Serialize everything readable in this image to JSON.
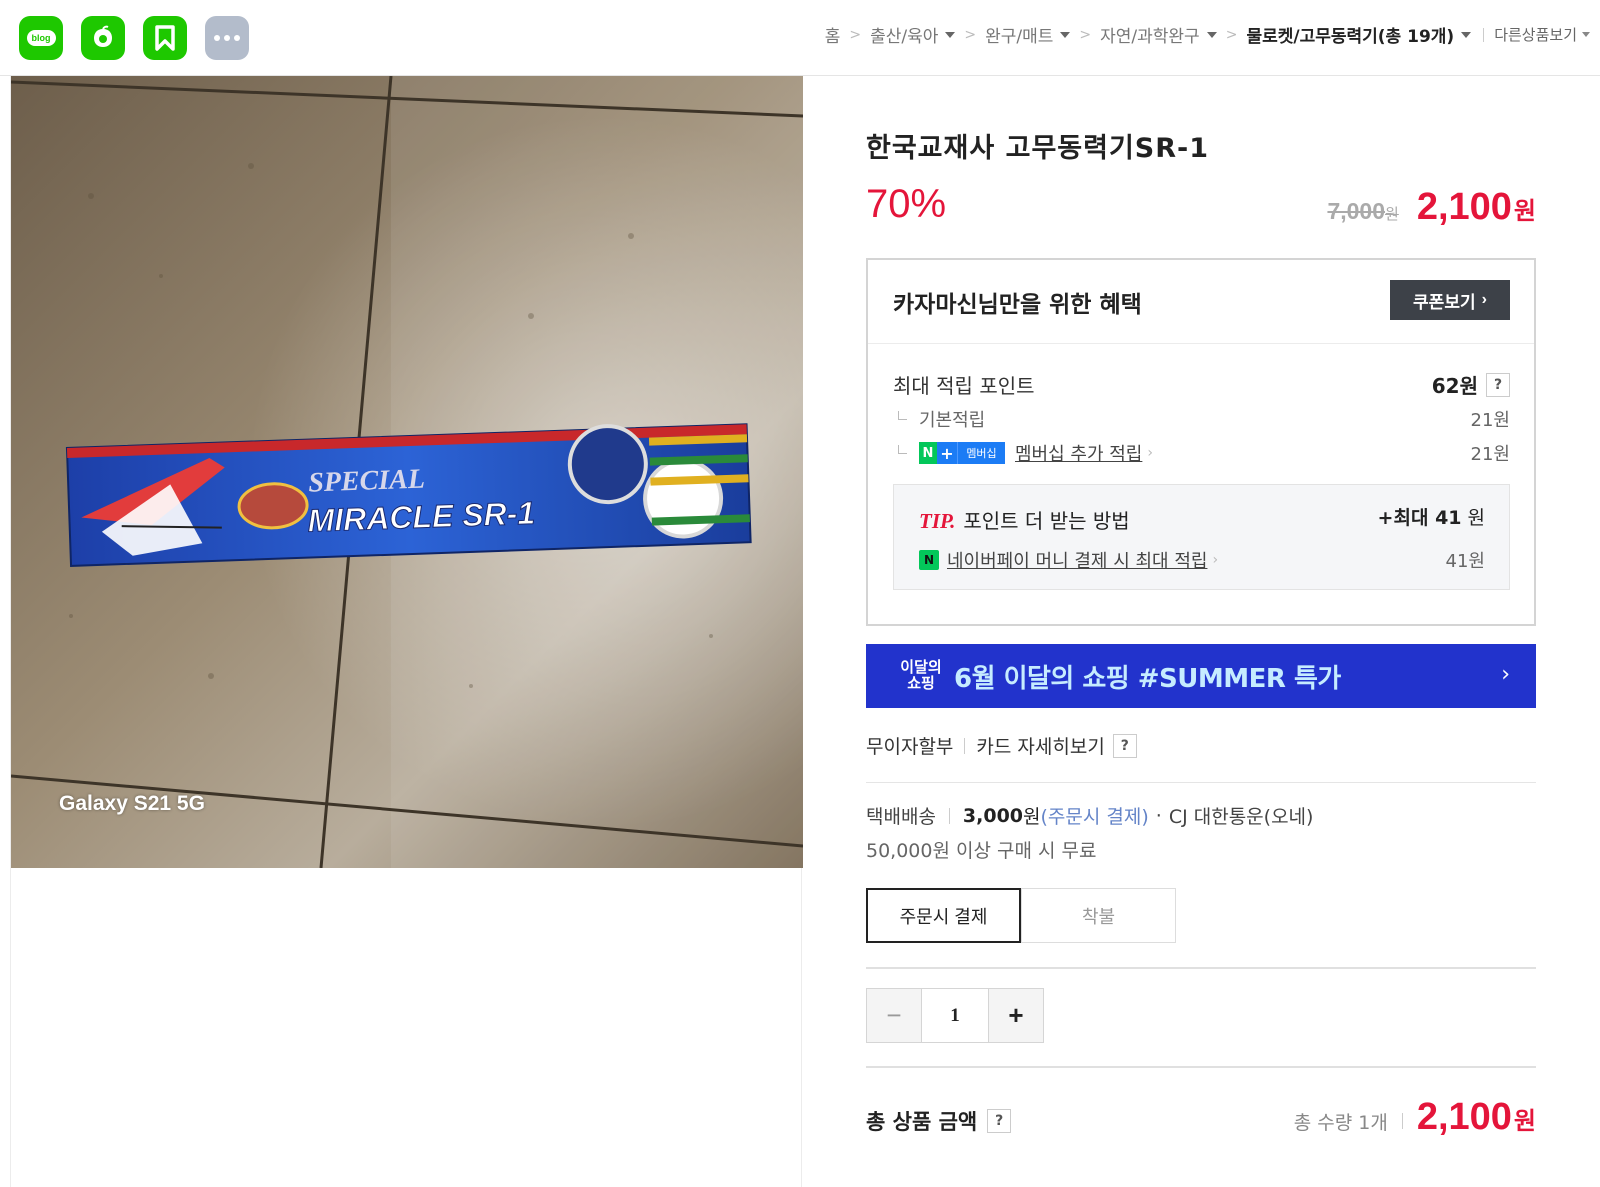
{
  "topbar": {
    "apps": [
      {
        "icon": "blog-icon",
        "label": "blog"
      },
      {
        "icon": "cafe-icon"
      },
      {
        "icon": "bookmark-icon"
      },
      {
        "icon": "more-icon"
      }
    ],
    "breadcrumb": {
      "home": "홈",
      "items": [
        "출산/육아",
        "완구/매트",
        "자연/과학완구"
      ],
      "current": "물로켓/고무동력기",
      "current_count": "(총 19개)",
      "other": "다른상품보기"
    }
  },
  "photo": {
    "watermark": "Galaxy S21 5G",
    "box_text_top": "SPECIAL",
    "box_text_main": "MIRACLE SR-1"
  },
  "product": {
    "title": "한국교재사 고무동력기SR-1",
    "discount": "70%",
    "original_price": "7,000",
    "original_unit": "원",
    "sale_price": "2,100",
    "sale_unit": "원"
  },
  "benefit": {
    "title": "카자마신님만을 위한 혜택",
    "coupon_button": "쿠폰보기",
    "max_points_label": "최대 적립 포인트",
    "max_points_value": "62원",
    "basic_label": "기본적립",
    "basic_value": "21원",
    "membership_badge": "멤버십",
    "membership_label": "멤버십 추가 적립",
    "membership_value": "21원",
    "tip_label": "TIP.",
    "tip_title": "포인트 더 받는 방법",
    "tip_max_prefix": "+최대",
    "tip_max_value": "41",
    "tip_max_unit": "원",
    "npay_label": "네이버페이 머니 결제 시 최대 적립",
    "npay_value": "41원"
  },
  "banner": {
    "logo_line1": "이달의",
    "logo_line2": "쇼핑",
    "text": "6월 이달의 쇼핑 #SUMMER 특가"
  },
  "card": {
    "installment": "무이자할부",
    "detail": "카드 자세히보기"
  },
  "shipping": {
    "type": "택배배송",
    "fee": "3,000",
    "fee_unit": "원",
    "pay_type": "(주문시 결제)",
    "carrier": "CJ 대한통운(오네)",
    "free_note": "50,000원 이상 구매 시 무료",
    "options": [
      "주문시 결제",
      "착불"
    ],
    "selected": "주문시 결제"
  },
  "quantity": {
    "value": "1"
  },
  "total": {
    "label": "총 상품 금액",
    "qty_text": "총 수량 1개",
    "price": "2,100",
    "unit": "원"
  },
  "colors": {
    "accent_red": "#e4153a",
    "naver_green": "#1ec800",
    "banner_blue": "#2233cc"
  }
}
